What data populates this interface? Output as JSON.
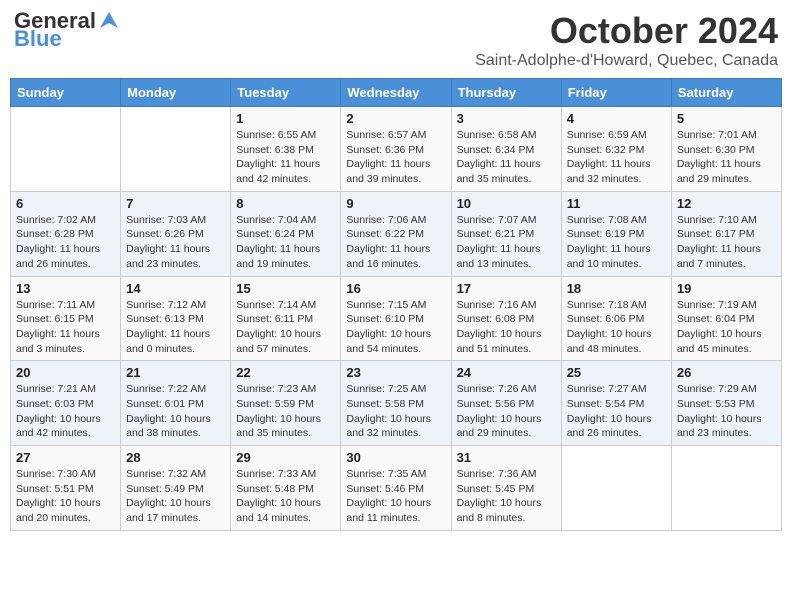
{
  "header": {
    "logo_general": "General",
    "logo_blue": "Blue",
    "title": "October 2024",
    "subtitle": "Saint-Adolphe-d'Howard, Quebec, Canada"
  },
  "weekdays": [
    "Sunday",
    "Monday",
    "Tuesday",
    "Wednesday",
    "Thursday",
    "Friday",
    "Saturday"
  ],
  "weeks": [
    [
      {
        "day": "",
        "info": ""
      },
      {
        "day": "",
        "info": ""
      },
      {
        "day": "1",
        "info": "Sunrise: 6:55 AM\nSunset: 6:38 PM\nDaylight: 11 hours and 42 minutes."
      },
      {
        "day": "2",
        "info": "Sunrise: 6:57 AM\nSunset: 6:36 PM\nDaylight: 11 hours and 39 minutes."
      },
      {
        "day": "3",
        "info": "Sunrise: 6:58 AM\nSunset: 6:34 PM\nDaylight: 11 hours and 35 minutes."
      },
      {
        "day": "4",
        "info": "Sunrise: 6:59 AM\nSunset: 6:32 PM\nDaylight: 11 hours and 32 minutes."
      },
      {
        "day": "5",
        "info": "Sunrise: 7:01 AM\nSunset: 6:30 PM\nDaylight: 11 hours and 29 minutes."
      }
    ],
    [
      {
        "day": "6",
        "info": "Sunrise: 7:02 AM\nSunset: 6:28 PM\nDaylight: 11 hours and 26 minutes."
      },
      {
        "day": "7",
        "info": "Sunrise: 7:03 AM\nSunset: 6:26 PM\nDaylight: 11 hours and 23 minutes."
      },
      {
        "day": "8",
        "info": "Sunrise: 7:04 AM\nSunset: 6:24 PM\nDaylight: 11 hours and 19 minutes."
      },
      {
        "day": "9",
        "info": "Sunrise: 7:06 AM\nSunset: 6:22 PM\nDaylight: 11 hours and 16 minutes."
      },
      {
        "day": "10",
        "info": "Sunrise: 7:07 AM\nSunset: 6:21 PM\nDaylight: 11 hours and 13 minutes."
      },
      {
        "day": "11",
        "info": "Sunrise: 7:08 AM\nSunset: 6:19 PM\nDaylight: 11 hours and 10 minutes."
      },
      {
        "day": "12",
        "info": "Sunrise: 7:10 AM\nSunset: 6:17 PM\nDaylight: 11 hours and 7 minutes."
      }
    ],
    [
      {
        "day": "13",
        "info": "Sunrise: 7:11 AM\nSunset: 6:15 PM\nDaylight: 11 hours and 3 minutes."
      },
      {
        "day": "14",
        "info": "Sunrise: 7:12 AM\nSunset: 6:13 PM\nDaylight: 11 hours and 0 minutes."
      },
      {
        "day": "15",
        "info": "Sunrise: 7:14 AM\nSunset: 6:11 PM\nDaylight: 10 hours and 57 minutes."
      },
      {
        "day": "16",
        "info": "Sunrise: 7:15 AM\nSunset: 6:10 PM\nDaylight: 10 hours and 54 minutes."
      },
      {
        "day": "17",
        "info": "Sunrise: 7:16 AM\nSunset: 6:08 PM\nDaylight: 10 hours and 51 minutes."
      },
      {
        "day": "18",
        "info": "Sunrise: 7:18 AM\nSunset: 6:06 PM\nDaylight: 10 hours and 48 minutes."
      },
      {
        "day": "19",
        "info": "Sunrise: 7:19 AM\nSunset: 6:04 PM\nDaylight: 10 hours and 45 minutes."
      }
    ],
    [
      {
        "day": "20",
        "info": "Sunrise: 7:21 AM\nSunset: 6:03 PM\nDaylight: 10 hours and 42 minutes."
      },
      {
        "day": "21",
        "info": "Sunrise: 7:22 AM\nSunset: 6:01 PM\nDaylight: 10 hours and 38 minutes."
      },
      {
        "day": "22",
        "info": "Sunrise: 7:23 AM\nSunset: 5:59 PM\nDaylight: 10 hours and 35 minutes."
      },
      {
        "day": "23",
        "info": "Sunrise: 7:25 AM\nSunset: 5:58 PM\nDaylight: 10 hours and 32 minutes."
      },
      {
        "day": "24",
        "info": "Sunrise: 7:26 AM\nSunset: 5:56 PM\nDaylight: 10 hours and 29 minutes."
      },
      {
        "day": "25",
        "info": "Sunrise: 7:27 AM\nSunset: 5:54 PM\nDaylight: 10 hours and 26 minutes."
      },
      {
        "day": "26",
        "info": "Sunrise: 7:29 AM\nSunset: 5:53 PM\nDaylight: 10 hours and 23 minutes."
      }
    ],
    [
      {
        "day": "27",
        "info": "Sunrise: 7:30 AM\nSunset: 5:51 PM\nDaylight: 10 hours and 20 minutes."
      },
      {
        "day": "28",
        "info": "Sunrise: 7:32 AM\nSunset: 5:49 PM\nDaylight: 10 hours and 17 minutes."
      },
      {
        "day": "29",
        "info": "Sunrise: 7:33 AM\nSunset: 5:48 PM\nDaylight: 10 hours and 14 minutes."
      },
      {
        "day": "30",
        "info": "Sunrise: 7:35 AM\nSunset: 5:46 PM\nDaylight: 10 hours and 11 minutes."
      },
      {
        "day": "31",
        "info": "Sunrise: 7:36 AM\nSunset: 5:45 PM\nDaylight: 10 hours and 8 minutes."
      },
      {
        "day": "",
        "info": ""
      },
      {
        "day": "",
        "info": ""
      }
    ]
  ]
}
